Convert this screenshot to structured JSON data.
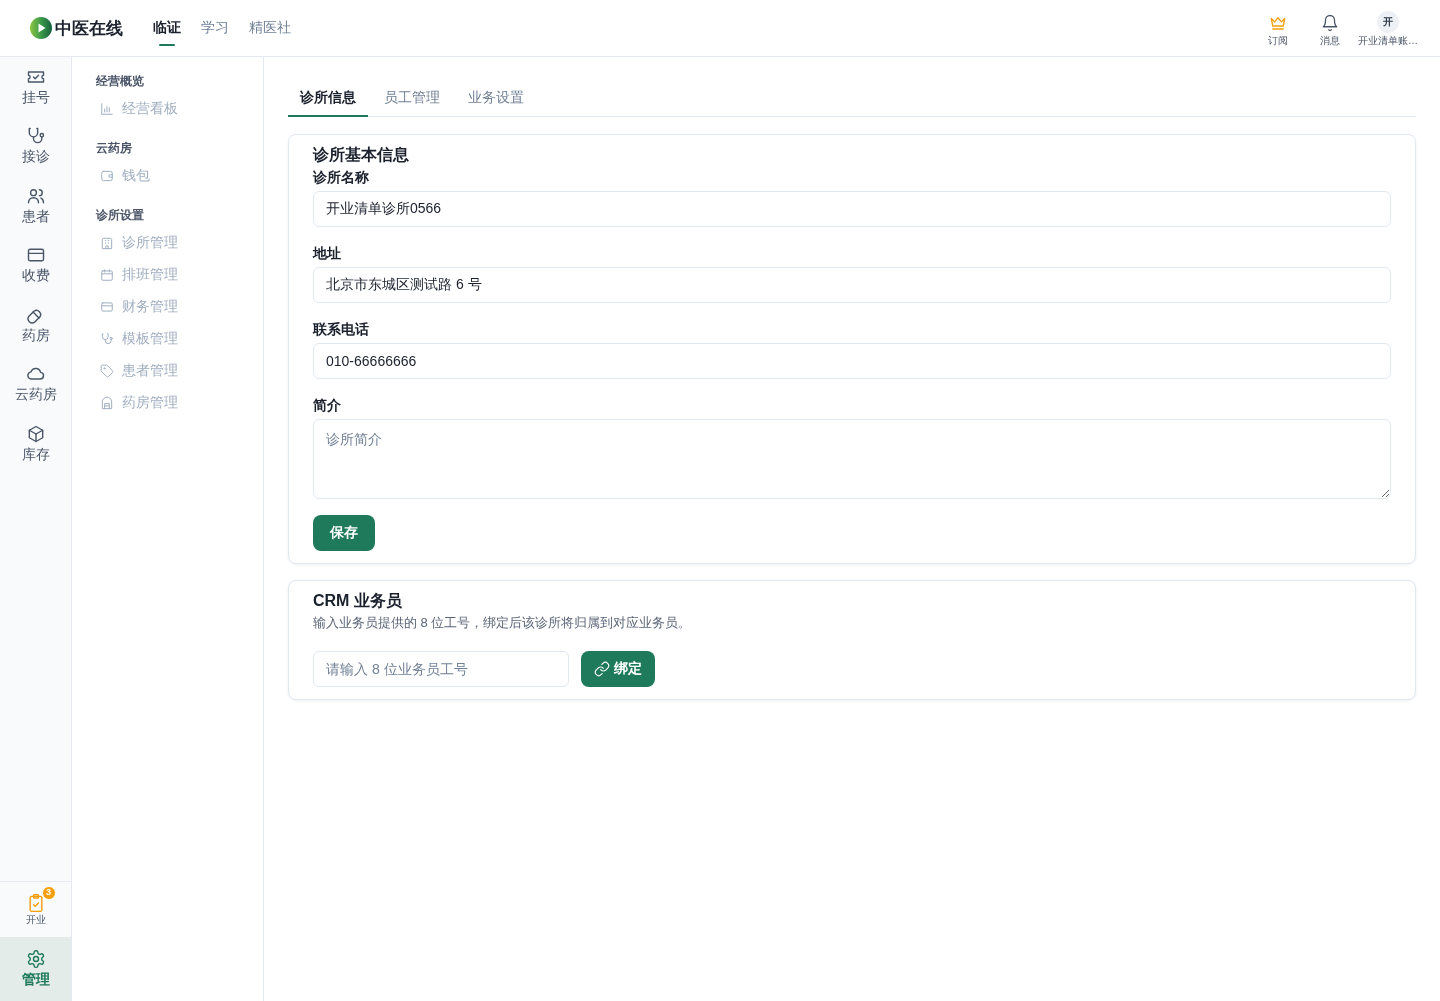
{
  "header": {
    "brand": "中医在线",
    "nav": [
      {
        "label": "临证",
        "selected": true
      },
      {
        "label": "学习",
        "selected": false
      },
      {
        "label": "精医社",
        "selected": false
      }
    ],
    "actions": [
      {
        "label": "订阅"
      },
      {
        "label": "消息"
      }
    ],
    "account": {
      "initial": "开",
      "name": "开业清单账…"
    }
  },
  "rail": {
    "items": [
      {
        "label": "挂号",
        "selected": false
      },
      {
        "label": "接诊",
        "selected": false
      },
      {
        "label": "患者",
        "selected": false
      },
      {
        "label": "收费",
        "selected": false
      },
      {
        "label": "药房",
        "selected": false
      },
      {
        "label": "云药房",
        "selected": false
      },
      {
        "label": "库存",
        "selected": false
      }
    ],
    "footer_items": [
      {
        "kind": "task",
        "label": "开业",
        "badge": "3",
        "selected": false
      },
      {
        "kind": "nav",
        "label": "管理",
        "selected": true
      }
    ]
  },
  "submenu": {
    "groups": [
      {
        "title": "经营概览",
        "items": [
          {
            "label": "经营看板",
            "selected": false
          }
        ]
      },
      {
        "title": "云药房",
        "items": [
          {
            "label": "钱包",
            "selected": false
          }
        ]
      },
      {
        "title": "诊所设置",
        "items": [
          {
            "label": "诊所管理",
            "selected": false
          },
          {
            "label": "排班管理",
            "selected": false
          },
          {
            "label": "财务管理",
            "selected": false
          },
          {
            "label": "模板管理",
            "selected": false
          },
          {
            "label": "患者管理",
            "selected": false
          },
          {
            "label": "药房管理",
            "selected": false
          }
        ]
      }
    ]
  },
  "tabs": [
    {
      "label": "诊所信息",
      "selected": true
    },
    {
      "label": "员工管理",
      "selected": false
    },
    {
      "label": "业务设置",
      "selected": false
    }
  ],
  "clinic_info": {
    "title": "诊所基本信息",
    "fields": [
      {
        "kind": "input",
        "label": "诊所名称",
        "value": "开业清单诊所0566"
      },
      {
        "kind": "input",
        "label": "地址",
        "value": "北京市东城区测试路 6 号"
      },
      {
        "kind": "input",
        "label": "联系电话",
        "value": "010-66666666"
      },
      {
        "kind": "textarea",
        "label": "简介",
        "placeholder": "诊所简介"
      }
    ],
    "save_button": "保存"
  },
  "crm": {
    "title": "CRM 业务员",
    "description": "输入业务员提供的 8 位工号，绑定后该诊所将归属到对应业务员。",
    "input": {
      "placeholder": "请输入 8 位业务员工号"
    },
    "bind_button": "绑定"
  }
}
